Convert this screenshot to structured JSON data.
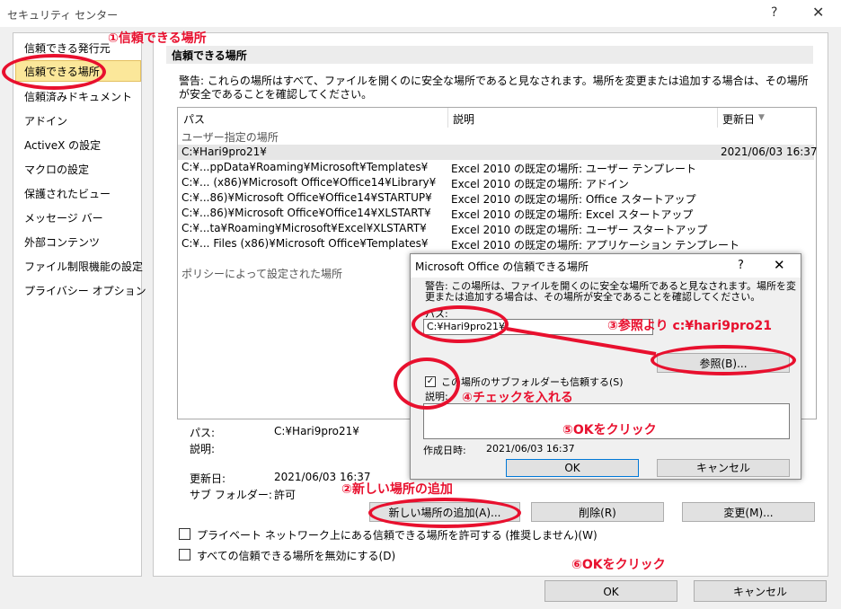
{
  "window": {
    "title": "セキュリティ センター",
    "help": "?",
    "close": "✕"
  },
  "sidebar": {
    "items": [
      {
        "label": "信頼できる発行元"
      },
      {
        "label": "信頼できる場所"
      },
      {
        "label": "信頼済みドキュメント"
      },
      {
        "label": "アドイン"
      },
      {
        "label": "ActiveX の設定"
      },
      {
        "label": "マクロの設定"
      },
      {
        "label": "保護されたビュー"
      },
      {
        "label": "メッセージ バー"
      },
      {
        "label": "外部コンテンツ"
      },
      {
        "label": "ファイル制限機能の設定"
      },
      {
        "label": "プライバシー オプション"
      }
    ]
  },
  "main": {
    "header": "信頼できる場所",
    "warning": "警告: これらの場所はすべて、ファイルを開くのに安全な場所であると見なされます。場所を変更または追加する場合は、その場所が安全であることを確認してください。",
    "columns": {
      "path": "パス",
      "desc": "説明",
      "modified": "更新日"
    },
    "user_group": "ユーザー指定の場所",
    "rows": [
      {
        "path": "C:¥Hari9pro21¥",
        "desc": "",
        "date": "2021/06/03 16:37"
      },
      {
        "path": "C:¥...ppData¥Roaming¥Microsoft¥Templates¥",
        "desc": "Excel 2010 の既定の場所: ユーザー テンプレート",
        "date": ""
      },
      {
        "path": "C:¥... (x86)¥Microsoft Office¥Office14¥Library¥",
        "desc": "Excel 2010 の既定の場所: アドイン",
        "date": ""
      },
      {
        "path": "C:¥...86)¥Microsoft Office¥Office14¥STARTUP¥",
        "desc": "Excel 2010 の既定の場所: Office スタートアップ",
        "date": ""
      },
      {
        "path": "C:¥...86)¥Microsoft Office¥Office14¥XLSTART¥",
        "desc": "Excel 2010 の既定の場所: Excel スタートアップ",
        "date": ""
      },
      {
        "path": "C:¥...ta¥Roaming¥Microsoft¥Excel¥XLSTART¥",
        "desc": "Excel 2010 の既定の場所: ユーザー スタートアップ",
        "date": ""
      },
      {
        "path": "C:¥... Files (x86)¥Microsoft Office¥Templates¥",
        "desc": "Excel 2010 の既定の場所: アプリケーション テンプレート",
        "date": ""
      }
    ],
    "policy_group": "ポリシーによって設定された場所",
    "details": {
      "path_label": "パス:",
      "path_value": "C:¥Hari9pro21¥",
      "desc_label": "説明:",
      "date_label": "更新日:",
      "date_value": "2021/06/03 16:37",
      "sub_label": "サブ フォルダー:",
      "sub_value": "許可"
    },
    "buttons": {
      "add": "新しい場所の追加(A)...",
      "remove": "削除(R)",
      "modify": "変更(M)..."
    },
    "options": {
      "allow_network": "プライベート ネットワーク上にある信頼できる場所を許可する (推奨しません)(W)",
      "disable_all": "すべての信頼できる場所を無効にする(D)"
    }
  },
  "dialog": {
    "title": "Microsoft Office の信頼できる場所",
    "help": "?",
    "close": "✕",
    "warning": "警告: この場所は、ファイルを開くのに安全な場所であると見なされます。場所を変更または追加する場合は、その場所が安全であることを確認してください。",
    "path_label": "パス:",
    "path_value": "C:¥Hari9pro21¥",
    "browse": "参照(B)...",
    "subfolders": "この場所のサブフォルダーも信頼する(S)",
    "desc_label": "説明:",
    "created_label": "作成日時:",
    "created_value": "2021/06/03 16:37",
    "ok": "OK",
    "cancel": "キャンセル"
  },
  "footer": {
    "ok": "OK",
    "cancel": "キャンセル"
  },
  "annotations": {
    "a1": "①信頼できる場所",
    "a2": "②新しい場所の追加",
    "a3": "③参照より c:¥hari9pro21",
    "a4": "④チェックを入れる",
    "a5": "⑤OKをクリック",
    "a6": "⑥OKをクリック"
  },
  "colors": {
    "annotation": "#e8102e",
    "selected": "#fbe79a"
  }
}
